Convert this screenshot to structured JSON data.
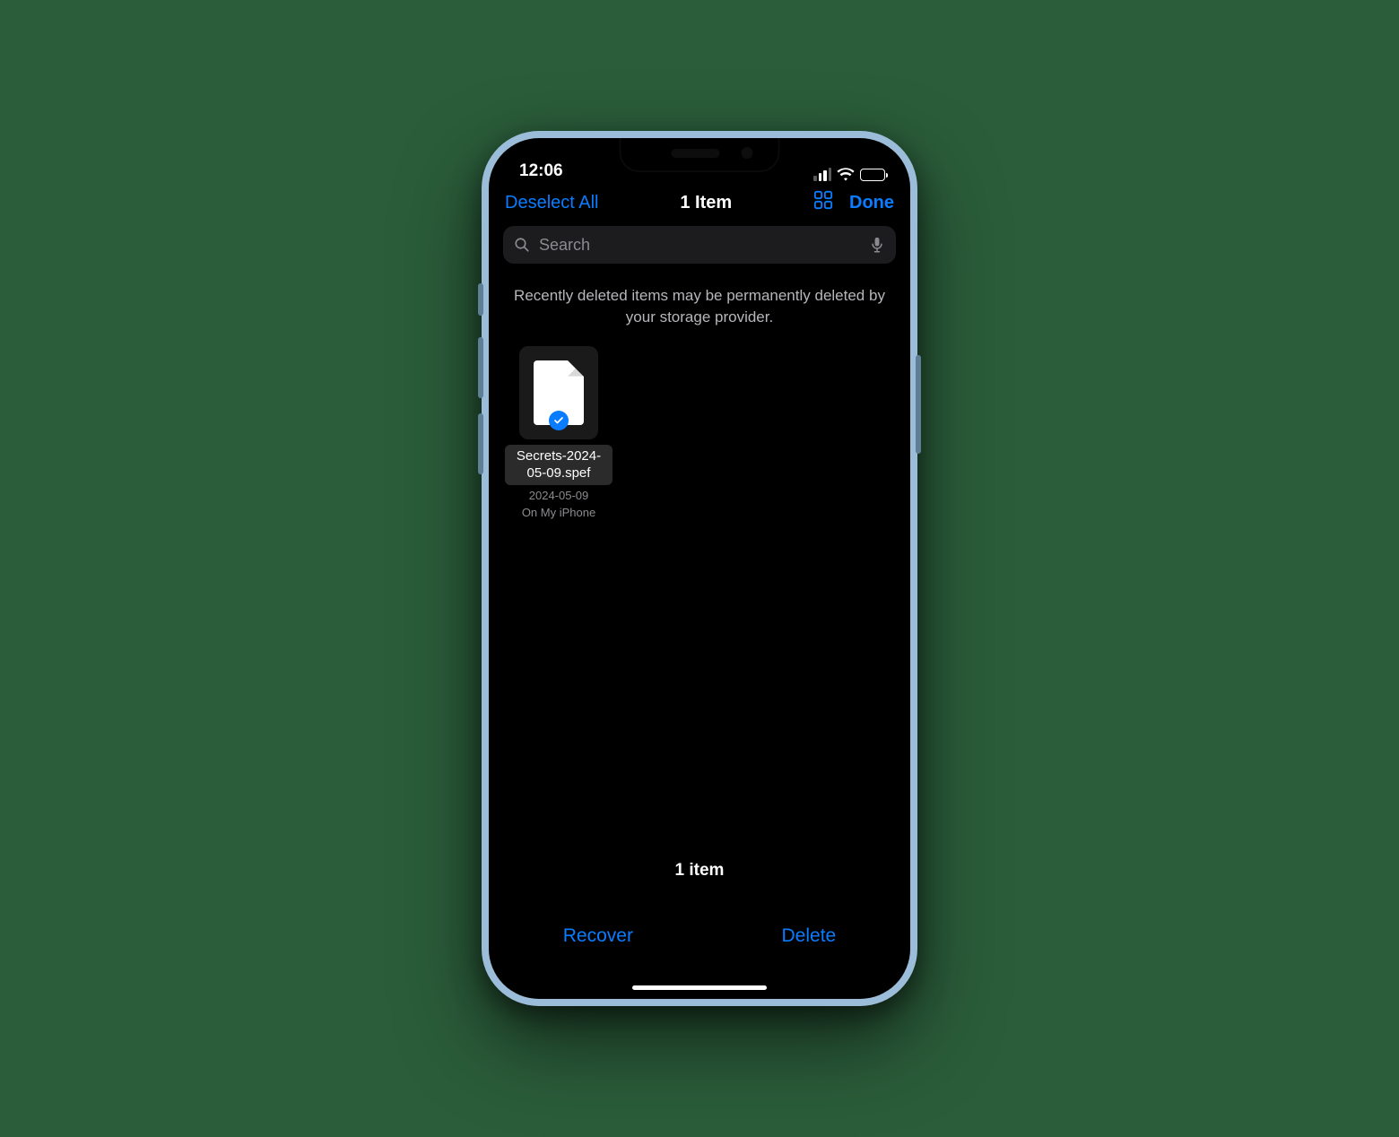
{
  "status": {
    "time": "12:06"
  },
  "navbar": {
    "deselect": "Deselect All",
    "title": "1 Item",
    "done": "Done"
  },
  "search": {
    "placeholder": "Search"
  },
  "notice": "Recently deleted items may be permanently deleted by your storage provider.",
  "file": {
    "name": "Secrets-2024-05-09.spef",
    "date": "2024-05-09",
    "location": "On My iPhone"
  },
  "footer": {
    "count": "1 item",
    "recover": "Recover",
    "delete": "Delete"
  }
}
